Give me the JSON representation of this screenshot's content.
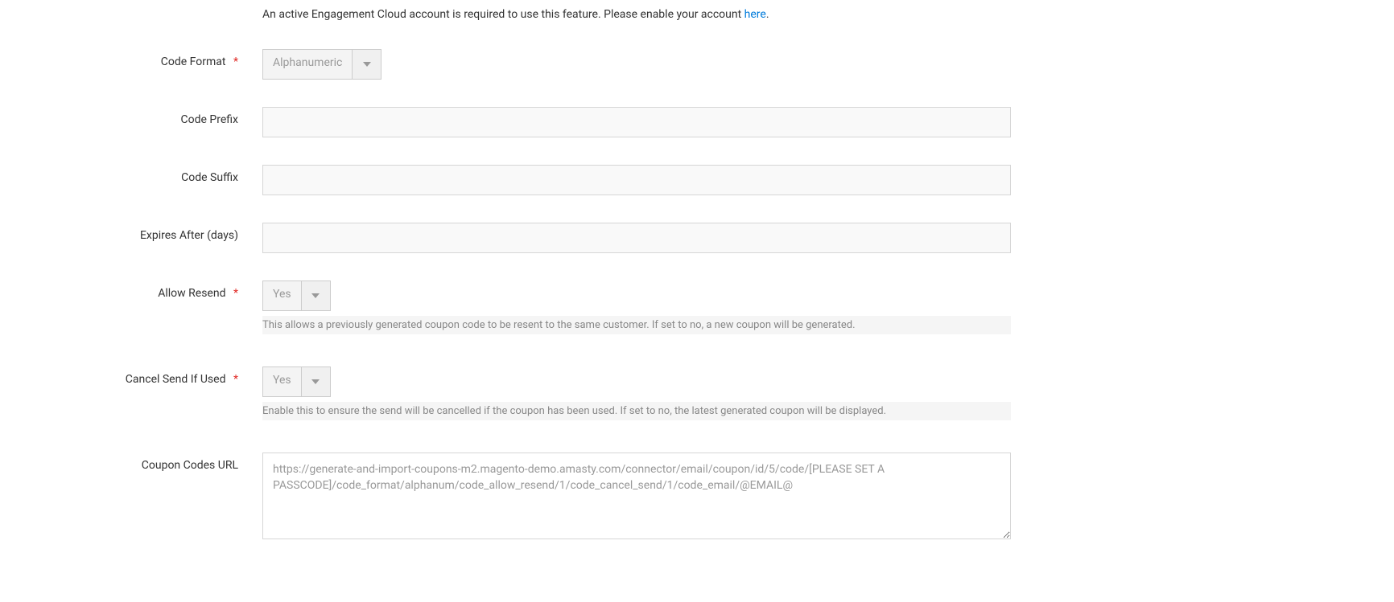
{
  "notice": {
    "text_prefix": "An active Engagement Cloud account is required to use this feature. Please enable your account ",
    "link_text": "here",
    "text_suffix": "."
  },
  "fields": {
    "code_format": {
      "label": "Code Format",
      "value": "Alphanumeric",
      "required": true
    },
    "code_prefix": {
      "label": "Code Prefix",
      "value": ""
    },
    "code_suffix": {
      "label": "Code Suffix",
      "value": ""
    },
    "expires_after": {
      "label": "Expires After (days)",
      "value": ""
    },
    "allow_resend": {
      "label": "Allow Resend",
      "value": "Yes",
      "required": true,
      "help": "This allows a previously generated coupon code to be resent to the same customer. If set to no, a new coupon will be generated."
    },
    "cancel_send": {
      "label": "Cancel Send If Used",
      "value": "Yes",
      "required": true,
      "help": "Enable this to ensure the send will be cancelled if the coupon has been used. If set to no, the latest generated coupon will be displayed."
    },
    "coupon_url": {
      "label": "Coupon Codes URL",
      "value": "https://generate-and-import-coupons-m2.magento-demo.amasty.com/connector/email/coupon/id/5/code/[PLEASE SET A PASSCODE]/code_format/alphanum/code_allow_resend/1/code_cancel_send/1/code_email/@EMAIL@"
    }
  }
}
